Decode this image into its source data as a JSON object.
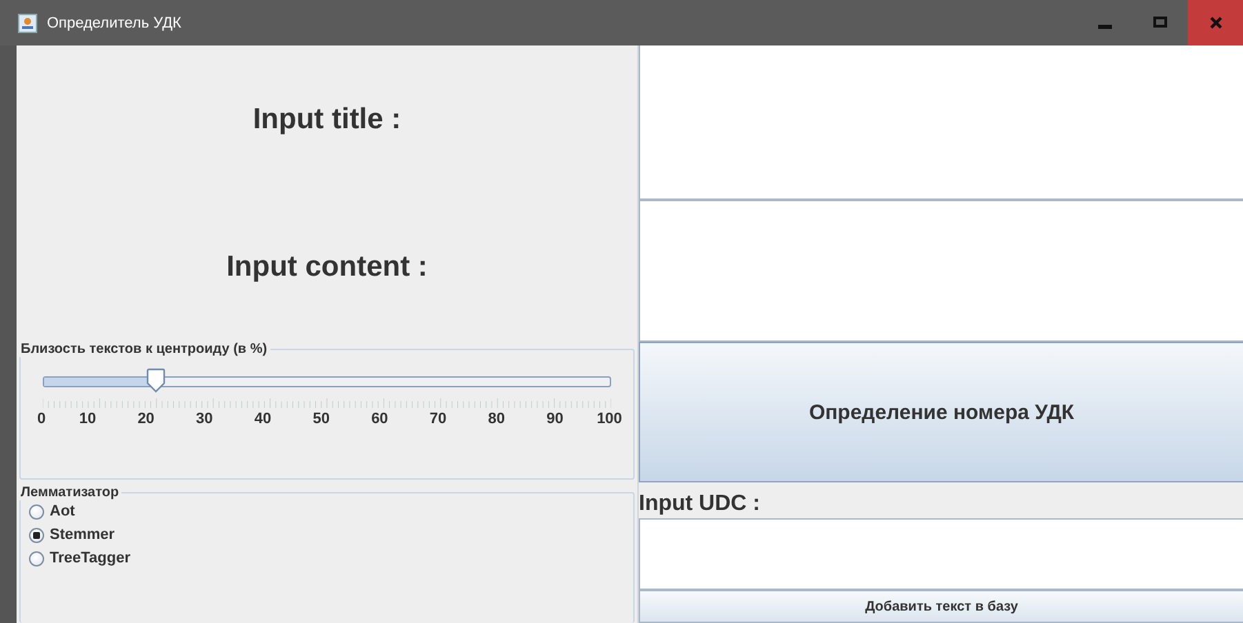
{
  "window": {
    "title": "Определитель УДК"
  },
  "left": {
    "title_label": "Input title :",
    "content_label": "Input content :"
  },
  "similarity": {
    "legend": "Близость текстов к центроиду (в %)",
    "level": 0.2,
    "scale": [
      "0",
      "10",
      "20",
      "30",
      "40",
      "50",
      "60",
      "70",
      "80",
      "90",
      "100"
    ]
  },
  "lemmatizer": {
    "legend": "Лемматизатор",
    "options": [
      {
        "label": "Aot",
        "selected": false
      },
      {
        "label": "Stemmer",
        "selected": true
      },
      {
        "label": "TreeTagger",
        "selected": false
      }
    ]
  },
  "right": {
    "determine_button": "Определение номера УДК",
    "udc_label": "Input UDC :",
    "add_button": "Добавить текст в базу"
  }
}
